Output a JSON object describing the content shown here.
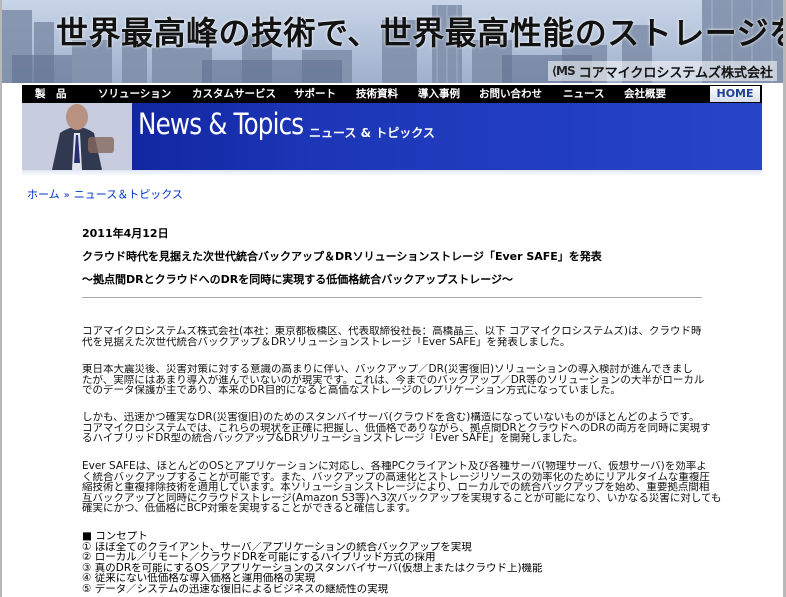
{
  "banner": {
    "title": "世界最高峰の技術で、世界最高性能のストレージを",
    "logo_mark": "⟨MS",
    "company": "コアマイクロシステムズ株式会社"
  },
  "nav": {
    "items": [
      "製　品",
      "ソリューション",
      "カスタムサービス",
      "サポート",
      "技術資料",
      "導入事例",
      "お問い合わせ",
      "ニュース",
      "会社概要"
    ],
    "home": "HOME"
  },
  "hero": {
    "title": "News & Topics",
    "subtitle": "ニュース & トピックス"
  },
  "breadcrumb": {
    "home": "ホーム",
    "separator": "»",
    "current": "ニュース＆トピックス"
  },
  "article": {
    "date": "2011年4月12日",
    "headline": "クラウド時代を見据えた次世代統合バックアップ＆DRソリューションストレージ「Ever SAFE」を発表",
    "subhead": "〜拠点間DRとクラウドへのDRを同時に実現する低価格統合バックアップストレージ〜",
    "paragraphs": [
      [
        "コアマイクロシステムズ株式会社(本社：東京都板橋区、代表取締役社長：高橋晶三、以下 コアマイクロシステムズ)は、クラウド時",
        "代を見据えた次世代統合バックアップ＆DRソリューションストレージ「Ever SAFE」を発表しました。"
      ],
      [
        "東日本大震災後、災害対策に対する意識の高まりに伴い、バックアップ／DR(災害復旧)ソリューションの導入検討が進んできまし",
        "たが、実際にはあまり導入が進んでいないのが現実です。これは、今までのバックアップ／DR等のソリューションの大半がローカル",
        "でのデータ保護が主であり、本来のDR目的になると高価なストレージのレプリケーション方式になっていました。"
      ],
      [
        "しかも、迅速かつ確実なDR(災害復旧)のためのスタンバイサーバ(クラウドを含む)構造になっていないものがほとんどのようです。",
        "コアマイクロシステムでは、これらの現状を正確に把握し、低価格でありながら、拠点間DRとクラウドへのDRの両方を同時に実現す",
        "るハイブリッドDR型の統合バックアップ&DRソリューションストレージ「Ever SAFE」を開発しました。"
      ],
      [
        "Ever SAFEは、ほとんどのOSとアプリケーションに対応し、各種PCクライアント及び各種サーバ(物理サーバ、仮想サーバ)を効率よ",
        "く統合バックアップすることが可能です。また、バックアップの高速化とストレージリソースの効率化のためにリアルタイムな重複圧",
        "縮技術と重複排除技術を適用しています。本ソリューションストレージにより、ローカルでの統合バックアップを始め、重要拠点間相",
        "互バックアップと同時にクラウドストレージ(Amazon S3等)へ3次バックアップを実現することが可能になり、いかなる災害に対しても",
        "確実にかつ、低価格にBCP対策を実現することができると確信します。"
      ]
    ],
    "concept_title": "■ コンセプト",
    "concept_items": [
      "① ほぼ全てのクライアント、サーバ／アプリケーションの統合バックアップを実現",
      "② ローカル／リモート／クラウドDRを可能にするハイブリッド方式の採用",
      "③ 真のDRを可能にするOS／アプリケーションのスタンバイサーバ(仮想上またはクラウド上)機能",
      "④ 従来にない低価格な導入価格と運用価格の実現",
      "⑤ データ／システムの迅速な復旧によるビジネスの継続性の実現"
    ]
  }
}
